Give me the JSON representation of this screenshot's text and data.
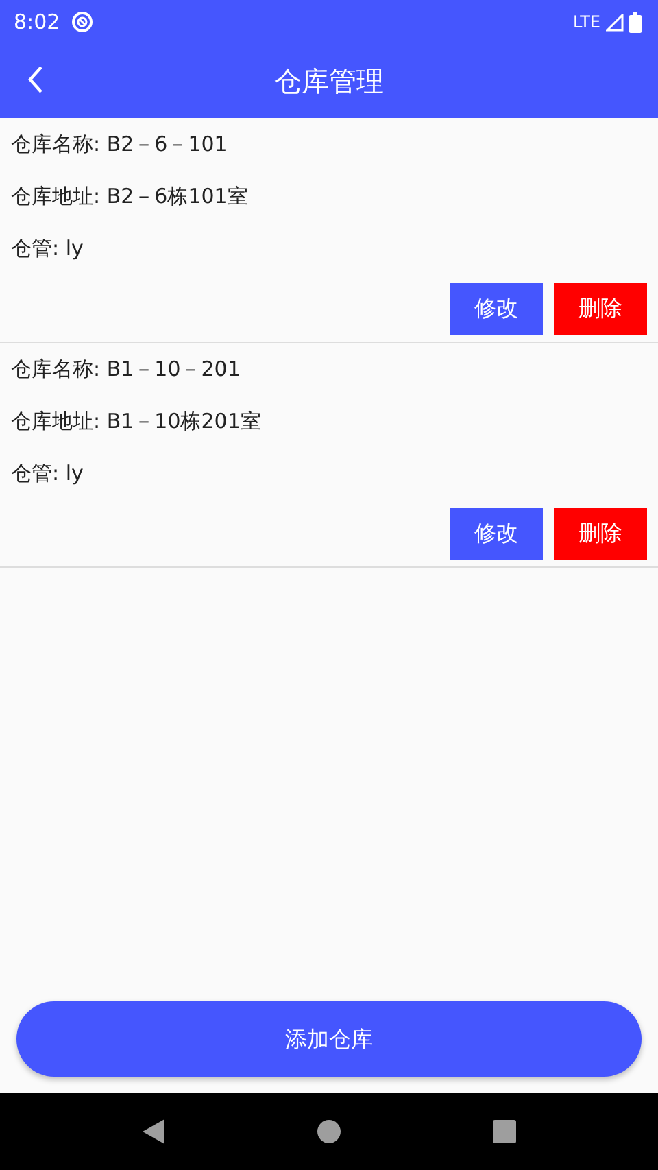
{
  "status_bar": {
    "time": "8:02",
    "network": "LTE"
  },
  "app_bar": {
    "title": "仓库管理"
  },
  "warehouses": [
    {
      "lines": [
        "仓库名称: B2－6－101",
        "仓库地址: B2－6栋101室",
        "仓管: ly"
      ],
      "buttons": [
        {
          "label": "修改",
          "kind": "edit"
        },
        {
          "label": "删除",
          "kind": "delete"
        }
      ]
    },
    {
      "lines": [
        "仓库名称: B1－10－201",
        "仓库地址: B1－10栋201室",
        "仓管: ly"
      ],
      "buttons": [
        {
          "label": "修改",
          "kind": "edit"
        },
        {
          "label": "删除",
          "kind": "delete"
        }
      ]
    }
  ],
  "add_button": {
    "label": "添加仓库"
  }
}
